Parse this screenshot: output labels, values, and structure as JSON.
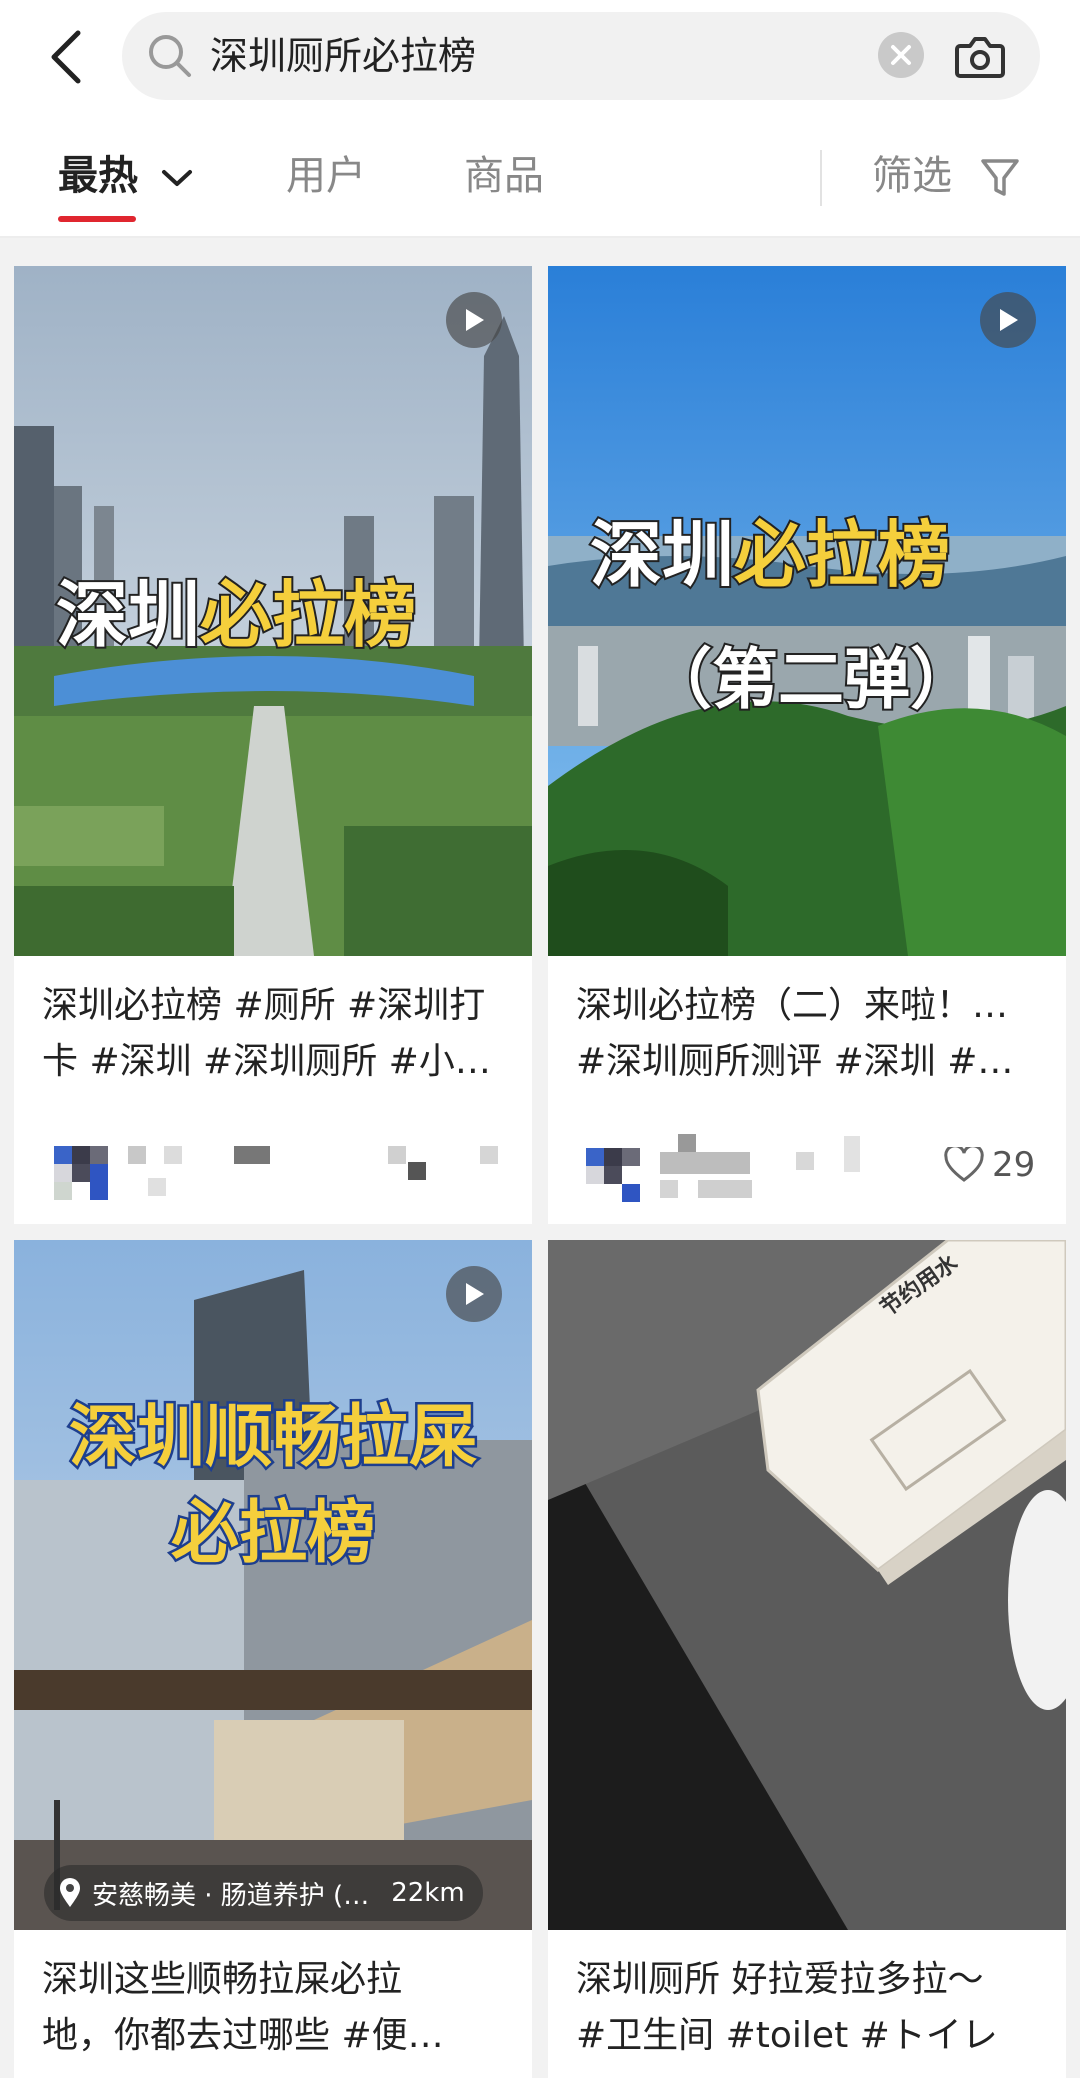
{
  "search": {
    "query": "深圳厕所必拉榜"
  },
  "tabs": {
    "hot": "最热",
    "users": "用户",
    "goods": "商品",
    "filter": "筛选"
  },
  "cards": [
    {
      "overlay_white": "深圳",
      "overlay_yellow": "必拉榜",
      "line1": "深圳必拉榜 #厕所 #深圳打",
      "line2": "卡 #深圳 #深圳厕所 #小…"
    },
    {
      "overlay_white": "深圳",
      "overlay_yellow": "必拉榜",
      "overlay_sub": "（第二弹）",
      "line1": "深圳必拉榜（二）来啦！…",
      "line2": "#深圳厕所测评 #深圳 #…",
      "likes": "29"
    },
    {
      "overlay_line1": "深圳顺畅拉屎",
      "overlay_line2": "必拉榜",
      "location": "安慈畅美 · 肠道养护 (…",
      "distance": "22km",
      "line1": "深圳这些顺畅拉屎必拉",
      "line2": "地，你都去过哪些 #便…"
    },
    {
      "box_label": "节约用水",
      "line1": "深圳厕所 好拉爱拉多拉～",
      "line2": "#卫生间 #toilet #トイレ"
    }
  ],
  "colors": {
    "accent": "#e0262f",
    "overlay_yellow": "#f5cf3c",
    "sky_blue": "#2a7fd8"
  }
}
